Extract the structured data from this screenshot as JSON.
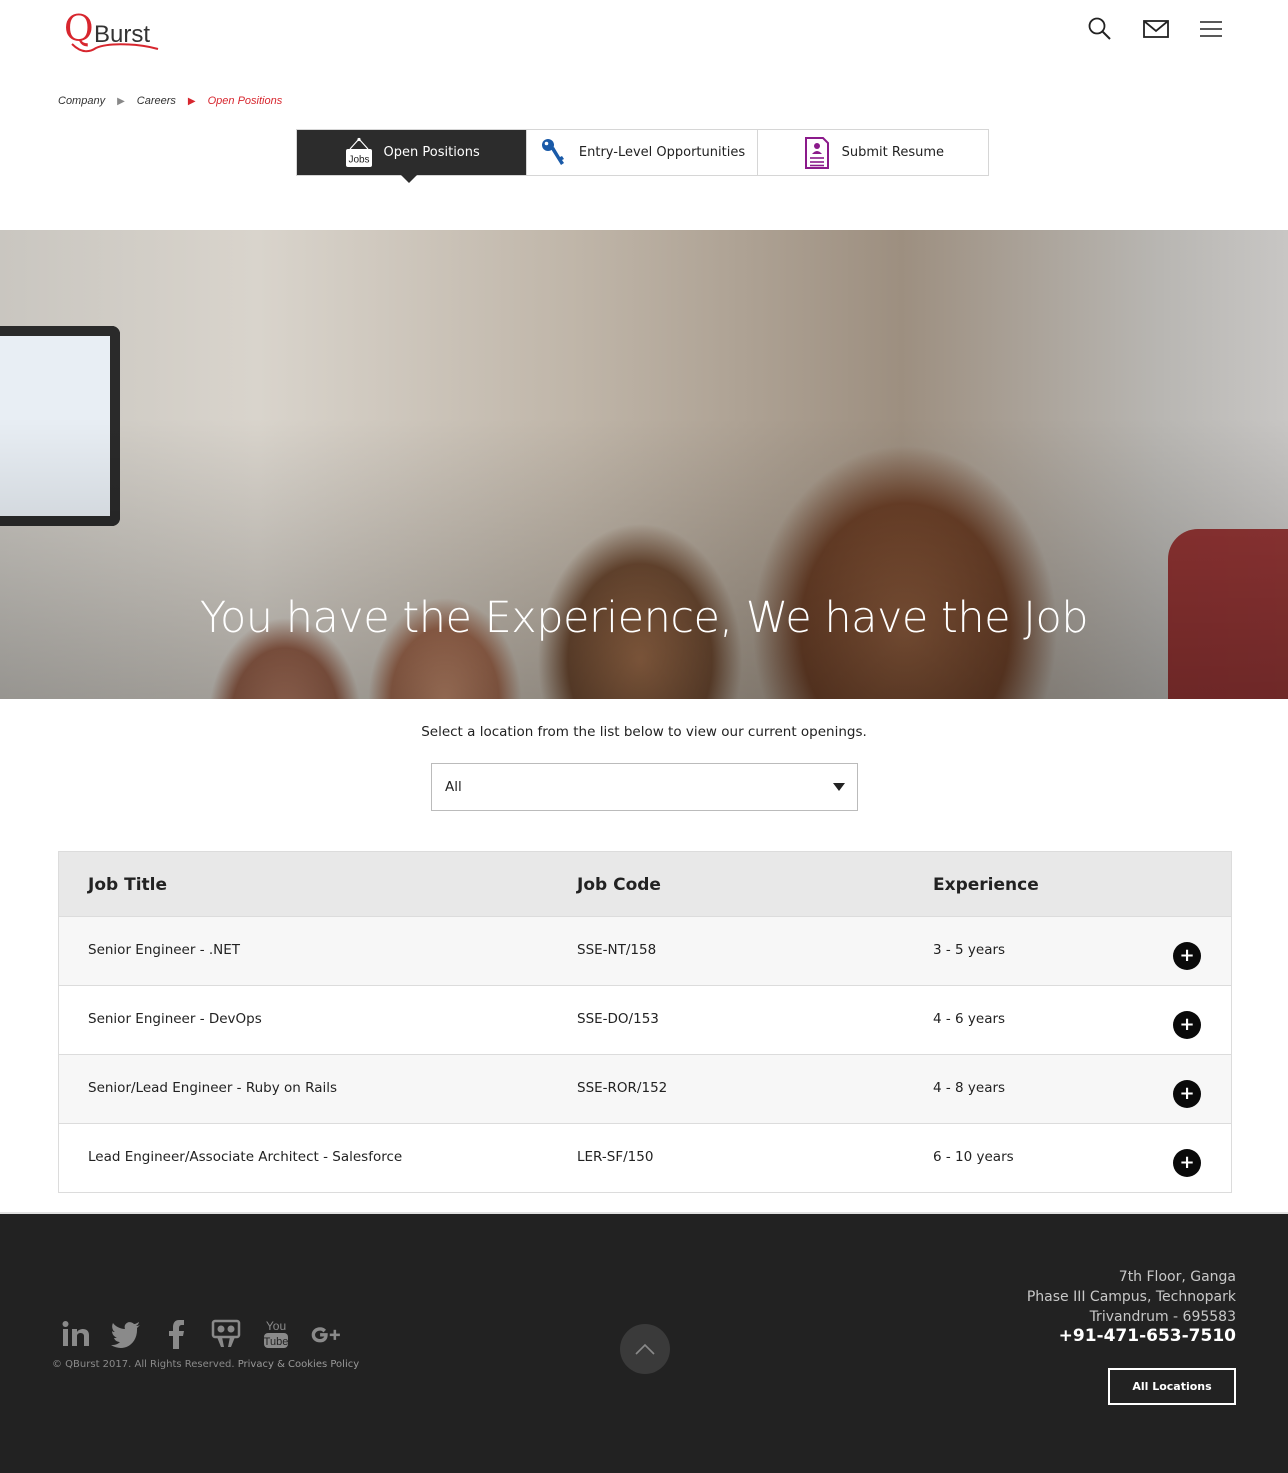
{
  "header": {
    "logo_q": "Q",
    "logo_text": "Burst",
    "icons": [
      "search-icon",
      "mail-icon",
      "menu-icon"
    ]
  },
  "breadcrumb": {
    "items": [
      "Company",
      "Careers",
      "Open Positions"
    ]
  },
  "tabs": [
    {
      "label": "Open Positions",
      "icon": "jobs-sign-icon",
      "icon_text": "Jobs",
      "active": true
    },
    {
      "label": "Entry-Level Opportunities",
      "icon": "key-icon",
      "active": false
    },
    {
      "label": "Submit Resume",
      "icon": "resume-icon",
      "active": false
    }
  ],
  "hero": {
    "title": "You have the Experience, We have the Job"
  },
  "location": {
    "prompt": "Select a location from the list below to view our current openings.",
    "selected": "All"
  },
  "jobs": {
    "headers": [
      "Job Title",
      "Job Code",
      "Experience"
    ],
    "rows": [
      {
        "title": "Senior Engineer - .NET",
        "code": "SSE-NT/158",
        "experience": "3 - 5 years"
      },
      {
        "title": "Senior Engineer - DevOps",
        "code": "SSE-DO/153",
        "experience": "4 - 6 years"
      },
      {
        "title": "Senior/Lead Engineer - Ruby on Rails",
        "code": "SSE-ROR/152",
        "experience": "4 - 8 years"
      },
      {
        "title": "Lead Engineer/Associate Architect - Salesforce",
        "code": "LER-SF/150",
        "experience": "6 - 10 years"
      }
    ],
    "expand_symbol": "+"
  },
  "footer": {
    "social": [
      "linkedin-icon",
      "twitter-icon",
      "facebook-icon",
      "slideshare-icon",
      "youtube-icon",
      "google-plus-icon"
    ],
    "copyright": "© QBurst 2017. All Rights Reserved.",
    "privacy": "Privacy & Cookies Policy",
    "address": [
      "7th Floor, Ganga",
      "Phase III Campus, Technopark",
      "Trivandrum - 695583"
    ],
    "phone": "+91-471-653-7510",
    "all_locations": "All Locations"
  },
  "colors": {
    "brand_red": "#d7262e",
    "active_tab": "#2c2c2c",
    "footer_bg": "#222222",
    "resume_purple": "#8b1a8b",
    "key_blue": "#1a5aa8"
  }
}
